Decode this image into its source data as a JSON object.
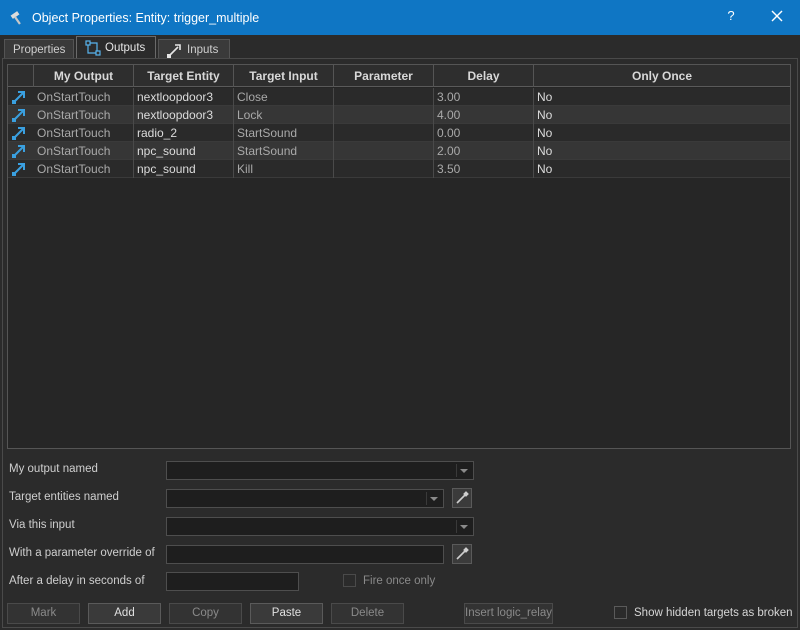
{
  "window": {
    "title": "Object Properties: Entity: trigger_multiple",
    "help_label": "?",
    "title_bar_color": "#0f76c4"
  },
  "tabs": [
    {
      "label": "Properties",
      "icon": null,
      "active": false
    },
    {
      "label": "Outputs",
      "icon": "outputs-connection-icon",
      "active": true
    },
    {
      "label": "Inputs",
      "icon": "inputs-connection-icon",
      "active": false
    }
  ],
  "table": {
    "columns": [
      "My Output",
      "Target Entity",
      "Target Input",
      "Parameter",
      "Delay",
      "Only Once"
    ],
    "rows": [
      {
        "my_output": "OnStartTouch",
        "target_entity": "nextloopdoor3",
        "target_input": "Close",
        "parameter": "",
        "delay": "3.00",
        "only_once": "No"
      },
      {
        "my_output": "OnStartTouch",
        "target_entity": "nextloopdoor3",
        "target_input": "Lock",
        "parameter": "",
        "delay": "4.00",
        "only_once": "No"
      },
      {
        "my_output": "OnStartTouch",
        "target_entity": "radio_2",
        "target_input": "StartSound",
        "parameter": "",
        "delay": "0.00",
        "only_once": "No"
      },
      {
        "my_output": "OnStartTouch",
        "target_entity": "npc_sound",
        "target_input": "StartSound",
        "parameter": "",
        "delay": "2.00",
        "only_once": "No"
      },
      {
        "my_output": "OnStartTouch",
        "target_entity": "npc_sound",
        "target_input": "Kill",
        "parameter": "",
        "delay": "3.50",
        "only_once": "No"
      }
    ]
  },
  "form": {
    "my_output_named": {
      "label": "My output named",
      "value": ""
    },
    "target_entities_named": {
      "label": "Target entities named",
      "value": ""
    },
    "via_this_input": {
      "label": "Via this input",
      "value": ""
    },
    "parameter_override": {
      "label": "With a parameter override of",
      "value": ""
    },
    "delay_seconds": {
      "label": "After a delay in seconds of",
      "value": ""
    },
    "fire_once_only": {
      "label": "Fire once only",
      "checked": false
    }
  },
  "buttons": {
    "mark": "Mark",
    "add": "Add",
    "copy": "Copy",
    "paste": "Paste",
    "delete": "Delete",
    "insert_logic_relay": "Insert logic_relay"
  },
  "show_hidden_targets": {
    "label": "Show hidden targets as broken",
    "checked": false
  },
  "colors": {
    "accent": "#0f76c4",
    "connection_icon": "#3aa0e0"
  }
}
